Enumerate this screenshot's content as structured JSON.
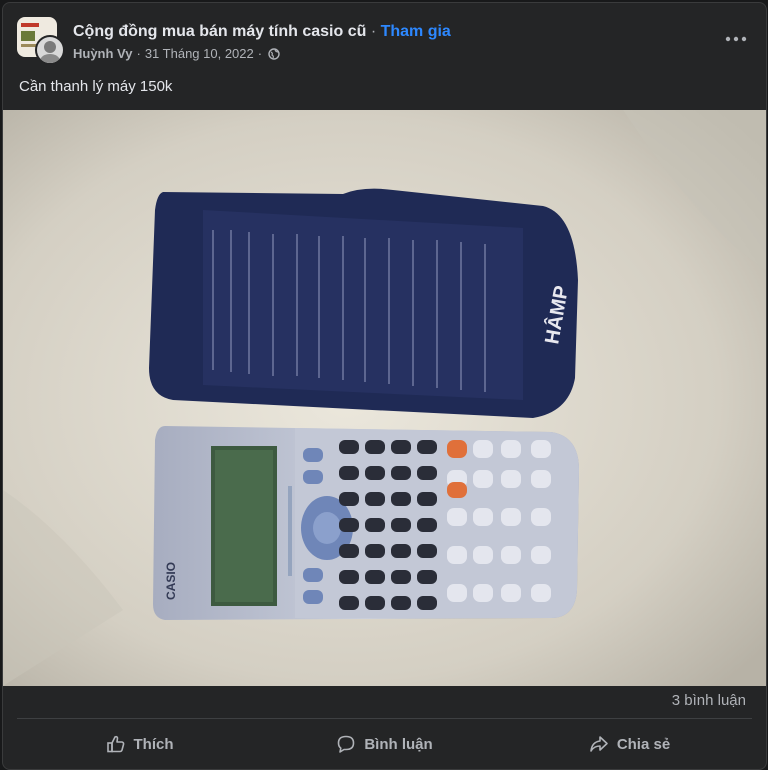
{
  "post": {
    "group_name": "Cộng đồng mua bán máy tính casio cũ",
    "separator": "·",
    "join_label": "Tham gia",
    "author": "Huỳnh Vy",
    "date": "31 Tháng 10, 2022",
    "meta_sep": "·",
    "privacy_icon": "globe-icon",
    "menu_icon": "more-horizontal-icon",
    "text": "Cần thanh lý máy 150k"
  },
  "photo": {
    "calculator_brand": "CASIO",
    "cover_text": "HÂMP"
  },
  "stats": {
    "comments": "3 bình luận"
  },
  "actions": {
    "like": {
      "label": "Thích",
      "icon": "thumbs-up-icon"
    },
    "comment": {
      "label": "Bình luận",
      "icon": "comment-bubble-icon"
    },
    "share": {
      "label": "Chia sẻ",
      "icon": "share-arrow-icon"
    }
  },
  "colors": {
    "background": "#18191a",
    "card": "#242526",
    "primary_text": "#e4e6eb",
    "secondary_text": "#b0b3b8",
    "link": "#2d88ff"
  }
}
